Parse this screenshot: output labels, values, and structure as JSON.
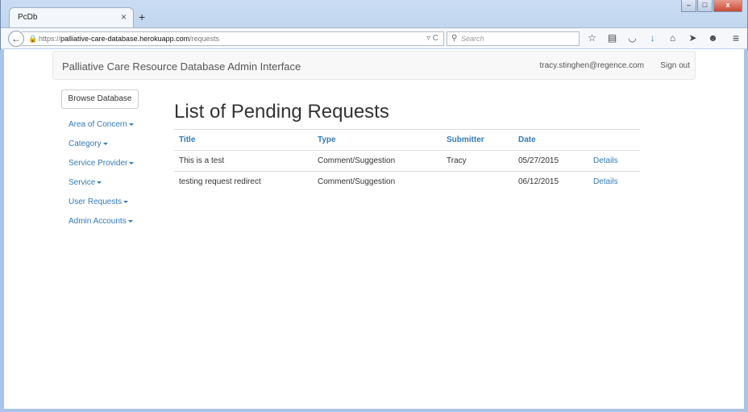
{
  "browser": {
    "tab_title": "PcDb",
    "tab_close": "×",
    "new_tab": "+",
    "url_prefix": "https://",
    "url_host": "palliative-care-database.herokuapp.com",
    "url_path": "/requests",
    "search_placeholder": "Search",
    "back": "←",
    "lock": "🔒",
    "url_actions": "▿ C",
    "search_glyph": "⚲",
    "menu": "≡",
    "window_buttons": {
      "minimize": "–",
      "maximize": "□",
      "close": "x"
    },
    "toolbar_icons": [
      "star-icon",
      "clipboard-icon",
      "pocket-icon",
      "download-icon",
      "home-icon",
      "send-icon",
      "chat-icon"
    ],
    "toolbar_glyphs": [
      "☆",
      "▤",
      "◡",
      "↓",
      "⌂",
      "➤",
      "☻"
    ]
  },
  "site": {
    "brand": "Palliative Care Resource Database Admin Interface",
    "user_email": "tracy.stinghen@regence.com",
    "sign_out": "Sign out"
  },
  "sidebar": {
    "browse_button": "Browse Database",
    "items": [
      {
        "label": "Area of Concern"
      },
      {
        "label": "Category"
      },
      {
        "label": "Service Provider"
      },
      {
        "label": "Service"
      },
      {
        "label": "User Requests"
      },
      {
        "label": "Admin Accounts"
      }
    ]
  },
  "main": {
    "heading": "List of Pending Requests",
    "columns": [
      "Title",
      "Type",
      "Submitter",
      "Date"
    ],
    "rows": [
      {
        "title": "This is a test",
        "type": "Comment/Suggestion",
        "submitter": "Tracy",
        "date": "05/27/2015",
        "action": "Details"
      },
      {
        "title": "testing request redirect",
        "type": "Comment/Suggestion",
        "submitter": "",
        "date": "06/12/2015",
        "action": "Details"
      }
    ]
  },
  "colors": {
    "link": "#337ab7",
    "text": "#333333",
    "navbar_bg": "#f8f8f8"
  }
}
